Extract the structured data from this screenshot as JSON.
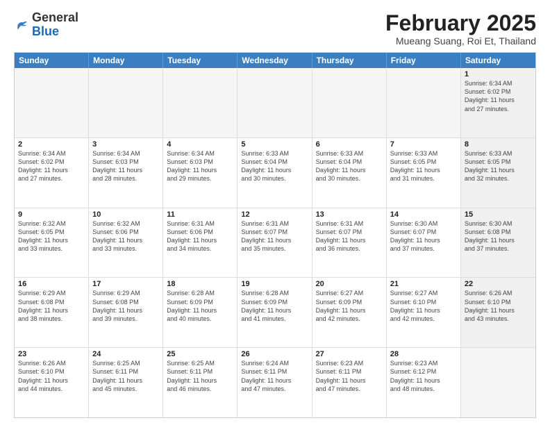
{
  "header": {
    "logo_general": "General",
    "logo_blue": "Blue",
    "month_title": "February 2025",
    "subtitle": "Mueang Suang, Roi Et, Thailand"
  },
  "days_of_week": [
    "Sunday",
    "Monday",
    "Tuesday",
    "Wednesday",
    "Thursday",
    "Friday",
    "Saturday"
  ],
  "weeks": [
    [
      {
        "day": "",
        "info": "",
        "empty": true
      },
      {
        "day": "",
        "info": "",
        "empty": true
      },
      {
        "day": "",
        "info": "",
        "empty": true
      },
      {
        "day": "",
        "info": "",
        "empty": true
      },
      {
        "day": "",
        "info": "",
        "empty": true
      },
      {
        "day": "",
        "info": "",
        "empty": true
      },
      {
        "day": "1",
        "info": "Sunrise: 6:34 AM\nSunset: 6:02 PM\nDaylight: 11 hours\nand 27 minutes.",
        "empty": false,
        "shaded": true
      }
    ],
    [
      {
        "day": "2",
        "info": "Sunrise: 6:34 AM\nSunset: 6:02 PM\nDaylight: 11 hours\nand 27 minutes.",
        "empty": false,
        "shaded": false
      },
      {
        "day": "3",
        "info": "Sunrise: 6:34 AM\nSunset: 6:03 PM\nDaylight: 11 hours\nand 28 minutes.",
        "empty": false,
        "shaded": false
      },
      {
        "day": "4",
        "info": "Sunrise: 6:34 AM\nSunset: 6:03 PM\nDaylight: 11 hours\nand 29 minutes.",
        "empty": false,
        "shaded": false
      },
      {
        "day": "5",
        "info": "Sunrise: 6:33 AM\nSunset: 6:04 PM\nDaylight: 11 hours\nand 30 minutes.",
        "empty": false,
        "shaded": false
      },
      {
        "day": "6",
        "info": "Sunrise: 6:33 AM\nSunset: 6:04 PM\nDaylight: 11 hours\nand 30 minutes.",
        "empty": false,
        "shaded": false
      },
      {
        "day": "7",
        "info": "Sunrise: 6:33 AM\nSunset: 6:05 PM\nDaylight: 11 hours\nand 31 minutes.",
        "empty": false,
        "shaded": false
      },
      {
        "day": "8",
        "info": "Sunrise: 6:33 AM\nSunset: 6:05 PM\nDaylight: 11 hours\nand 32 minutes.",
        "empty": false,
        "shaded": true
      }
    ],
    [
      {
        "day": "9",
        "info": "Sunrise: 6:32 AM\nSunset: 6:05 PM\nDaylight: 11 hours\nand 33 minutes.",
        "empty": false,
        "shaded": false
      },
      {
        "day": "10",
        "info": "Sunrise: 6:32 AM\nSunset: 6:06 PM\nDaylight: 11 hours\nand 33 minutes.",
        "empty": false,
        "shaded": false
      },
      {
        "day": "11",
        "info": "Sunrise: 6:31 AM\nSunset: 6:06 PM\nDaylight: 11 hours\nand 34 minutes.",
        "empty": false,
        "shaded": false
      },
      {
        "day": "12",
        "info": "Sunrise: 6:31 AM\nSunset: 6:07 PM\nDaylight: 11 hours\nand 35 minutes.",
        "empty": false,
        "shaded": false
      },
      {
        "day": "13",
        "info": "Sunrise: 6:31 AM\nSunset: 6:07 PM\nDaylight: 11 hours\nand 36 minutes.",
        "empty": false,
        "shaded": false
      },
      {
        "day": "14",
        "info": "Sunrise: 6:30 AM\nSunset: 6:07 PM\nDaylight: 11 hours\nand 37 minutes.",
        "empty": false,
        "shaded": false
      },
      {
        "day": "15",
        "info": "Sunrise: 6:30 AM\nSunset: 6:08 PM\nDaylight: 11 hours\nand 37 minutes.",
        "empty": false,
        "shaded": true
      }
    ],
    [
      {
        "day": "16",
        "info": "Sunrise: 6:29 AM\nSunset: 6:08 PM\nDaylight: 11 hours\nand 38 minutes.",
        "empty": false,
        "shaded": false
      },
      {
        "day": "17",
        "info": "Sunrise: 6:29 AM\nSunset: 6:08 PM\nDaylight: 11 hours\nand 39 minutes.",
        "empty": false,
        "shaded": false
      },
      {
        "day": "18",
        "info": "Sunrise: 6:28 AM\nSunset: 6:09 PM\nDaylight: 11 hours\nand 40 minutes.",
        "empty": false,
        "shaded": false
      },
      {
        "day": "19",
        "info": "Sunrise: 6:28 AM\nSunset: 6:09 PM\nDaylight: 11 hours\nand 41 minutes.",
        "empty": false,
        "shaded": false
      },
      {
        "day": "20",
        "info": "Sunrise: 6:27 AM\nSunset: 6:09 PM\nDaylight: 11 hours\nand 42 minutes.",
        "empty": false,
        "shaded": false
      },
      {
        "day": "21",
        "info": "Sunrise: 6:27 AM\nSunset: 6:10 PM\nDaylight: 11 hours\nand 42 minutes.",
        "empty": false,
        "shaded": false
      },
      {
        "day": "22",
        "info": "Sunrise: 6:26 AM\nSunset: 6:10 PM\nDaylight: 11 hours\nand 43 minutes.",
        "empty": false,
        "shaded": true
      }
    ],
    [
      {
        "day": "23",
        "info": "Sunrise: 6:26 AM\nSunset: 6:10 PM\nDaylight: 11 hours\nand 44 minutes.",
        "empty": false,
        "shaded": false
      },
      {
        "day": "24",
        "info": "Sunrise: 6:25 AM\nSunset: 6:11 PM\nDaylight: 11 hours\nand 45 minutes.",
        "empty": false,
        "shaded": false
      },
      {
        "day": "25",
        "info": "Sunrise: 6:25 AM\nSunset: 6:11 PM\nDaylight: 11 hours\nand 46 minutes.",
        "empty": false,
        "shaded": false
      },
      {
        "day": "26",
        "info": "Sunrise: 6:24 AM\nSunset: 6:11 PM\nDaylight: 11 hours\nand 47 minutes.",
        "empty": false,
        "shaded": false
      },
      {
        "day": "27",
        "info": "Sunrise: 6:23 AM\nSunset: 6:11 PM\nDaylight: 11 hours\nand 47 minutes.",
        "empty": false,
        "shaded": false
      },
      {
        "day": "28",
        "info": "Sunrise: 6:23 AM\nSunset: 6:12 PM\nDaylight: 11 hours\nand 48 minutes.",
        "empty": false,
        "shaded": false
      },
      {
        "day": "",
        "info": "",
        "empty": true,
        "shaded": true
      }
    ]
  ]
}
